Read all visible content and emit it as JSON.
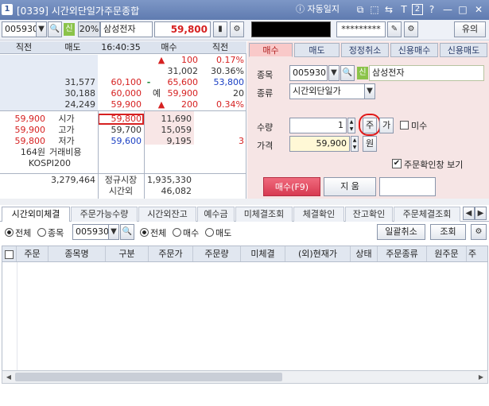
{
  "window": {
    "number": "1",
    "title": "[0339] 시간외단일가주문종합",
    "auto_save": "자동일지",
    "icons": [
      "info-icon",
      "layout-icon",
      "restore-icon",
      "swap-icon",
      "font-icon",
      "fit-icon",
      "help-icon",
      "minimize-icon",
      "maximize-icon",
      "close-icon"
    ],
    "icon_glyphs": [
      "⊕",
      "⧉",
      "⬚",
      "⇆",
      "T",
      "2",
      "?",
      "—",
      "□",
      "✕"
    ]
  },
  "toolbar": {
    "code": "005930",
    "sin": "신",
    "margin": "20%",
    "name": "삼성전자",
    "price": "59,800",
    "account_masked": "",
    "password": "*********",
    "notice": "유의"
  },
  "book": {
    "headers": [
      "직전",
      "매도",
      "16:40:35",
      "매수",
      "직전"
    ],
    "sell_rows": [
      {
        "qty": "",
        "price": "",
        "right_mark": "▲",
        "right_val": "100",
        "pct": "0.17%"
      },
      {
        "qty": "",
        "price": "",
        "right_mark": "",
        "right_val": "31,002",
        "pct": "30.36%"
      },
      {
        "qty": "31,577",
        "price": "60,100",
        "right_mark": "-",
        "right_val": "65,600",
        "pct": "53,800"
      },
      {
        "qty": "30,188",
        "price": "60,000",
        "right_mark": "예",
        "right_val": "59,900",
        "pct": "20"
      },
      {
        "qty": "24,249",
        "price": "59,900",
        "right_mark": "▲",
        "right_val": "200",
        "pct": "0.34%"
      }
    ],
    "info_rows": [
      {
        "prev": "59,900",
        "label": "시가",
        "price": "59,800",
        "buy": "11,690",
        "right": ""
      },
      {
        "prev": "59,900",
        "label": "고가",
        "price": "59,700",
        "buy": "15,059",
        "right": ""
      },
      {
        "prev": "59,800",
        "label": "저가",
        "price": "59,600",
        "buy": "9,195",
        "right": "3"
      },
      {
        "prev": "164원",
        "label": "거래비용",
        "price": "",
        "buy": "",
        "right": ""
      },
      {
        "prev": "KOSPI200",
        "label": "",
        "price": "",
        "buy": "",
        "right": ""
      }
    ],
    "footer": {
      "total_sell": "3,279,464",
      "market1": "정규시장",
      "market1_val": "1,935,330",
      "market2": "시간외",
      "market2_val": "46,082"
    }
  },
  "order": {
    "tabs": [
      "매수",
      "매도",
      "정정취소",
      "신용매수",
      "신용매도"
    ],
    "stock_label": "종목",
    "stock_code": "005930",
    "stock_name": "삼성전자",
    "type_label": "종류",
    "type_value": "시간외단일가",
    "qty_label": "수량",
    "qty_value": "1",
    "qty_btn1": "주",
    "qty_btn2": "가",
    "missu": "미수",
    "price_label": "가격",
    "price_value": "59,900",
    "price_unit": "원",
    "confirm_label": "주문확인창 보기",
    "buy_btn": "매수(F9)",
    "clear_btn": "지 움"
  },
  "bottom": {
    "tabs": [
      "시간외미체결",
      "주문가능수량",
      "시간외잔고",
      "예수금",
      "미체결조회",
      "체결확인",
      "잔고확인",
      "주문체결조회"
    ],
    "filter1": [
      "전체",
      "종목"
    ],
    "filter_code": "005930",
    "filter2": [
      "전체",
      "매수",
      "매도"
    ],
    "cancel_all": "일괄취소",
    "query": "조회",
    "columns": [
      "주문",
      "종목명",
      "구분",
      "주문가",
      "주문량",
      "미체결",
      "(외)현재가",
      "상태",
      "주문종류",
      "원주문",
      "주"
    ]
  }
}
